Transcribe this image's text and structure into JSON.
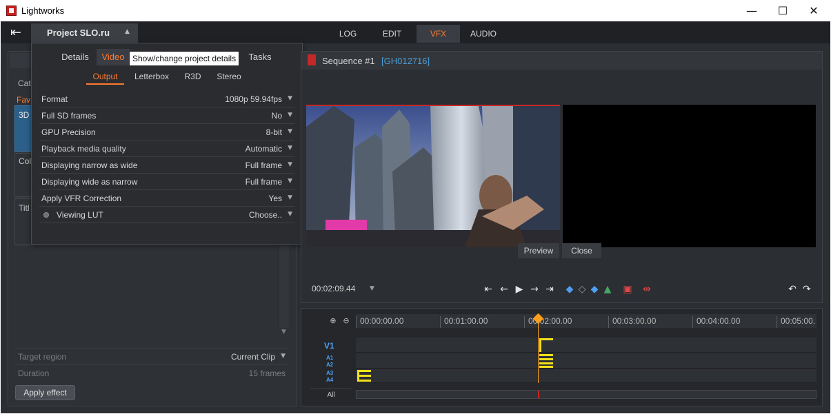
{
  "window": {
    "title": "Lightworks",
    "minimize": "—",
    "maximize": "☐",
    "close": "✕"
  },
  "project_tab": {
    "title": "Project SLO.ru",
    "arrow": "▲"
  },
  "nav_tabs": [
    {
      "label": "LOG"
    },
    {
      "label": "EDIT"
    },
    {
      "label": "VFX",
      "active": true
    },
    {
      "label": "AUDIO"
    }
  ],
  "left_panel": {
    "categories_label": "Cat",
    "favourites_label": "Fav",
    "categories": [
      "3D",
      "Col",
      "Titl"
    ],
    "target_region": {
      "label": "Target region",
      "value": "Current Clip",
      "arrow": "▼"
    },
    "duration": {
      "label": "Duration",
      "value": "15 frames"
    },
    "apply_button": "Apply effect"
  },
  "popup": {
    "tabs": [
      {
        "label": "Details"
      },
      {
        "label": "Video",
        "active": true
      },
      {
        "label": "Tasks"
      }
    ],
    "tooltip": "Show/change project details",
    "subtabs": [
      {
        "label": "Output",
        "active": true
      },
      {
        "label": "Letterbox"
      },
      {
        "label": "R3D"
      },
      {
        "label": "Stereo"
      }
    ],
    "settings": [
      {
        "label": "Format",
        "value": "1080p 59.94fps"
      },
      {
        "label": "Full SD frames",
        "value": "No"
      },
      {
        "label": "GPU Precision",
        "value": "8-bit"
      },
      {
        "label": "Playback media quality",
        "value": "Automatic"
      },
      {
        "label": "Displaying narrow as wide",
        "value": "Full frame"
      },
      {
        "label": "Displaying wide as narrow",
        "value": "Full frame"
      },
      {
        "label": "Apply VFR Correction",
        "value": "Yes"
      },
      {
        "label": "Viewing LUT",
        "value": "Choose.."
      }
    ],
    "dropdown_arrow": "▼"
  },
  "viewer": {
    "sequence_title": "Sequence #1",
    "sequence_id": "[GH012716]",
    "preview_button": "Preview",
    "close_button": "Close",
    "timecode": "00:02:09.44",
    "timecode_arrow": "▼"
  },
  "timeline": {
    "ticks": [
      "00:00:00.00",
      "00:01:00.00",
      "00:02:00.00",
      "00:03:00.00",
      "00:04:00.00",
      "00:05:00."
    ],
    "tracks": {
      "v1": "V1",
      "a1": "A1",
      "a2": "A2",
      "a3": "A3",
      "a4": "A4"
    },
    "all_label": "All"
  },
  "colors": {
    "accent": "#ff7a2e",
    "playhead": "#ff9f1a",
    "clip": "#f5e11a",
    "track_label": "#4e9ff0",
    "sequence_id": "#4a9fd8"
  }
}
